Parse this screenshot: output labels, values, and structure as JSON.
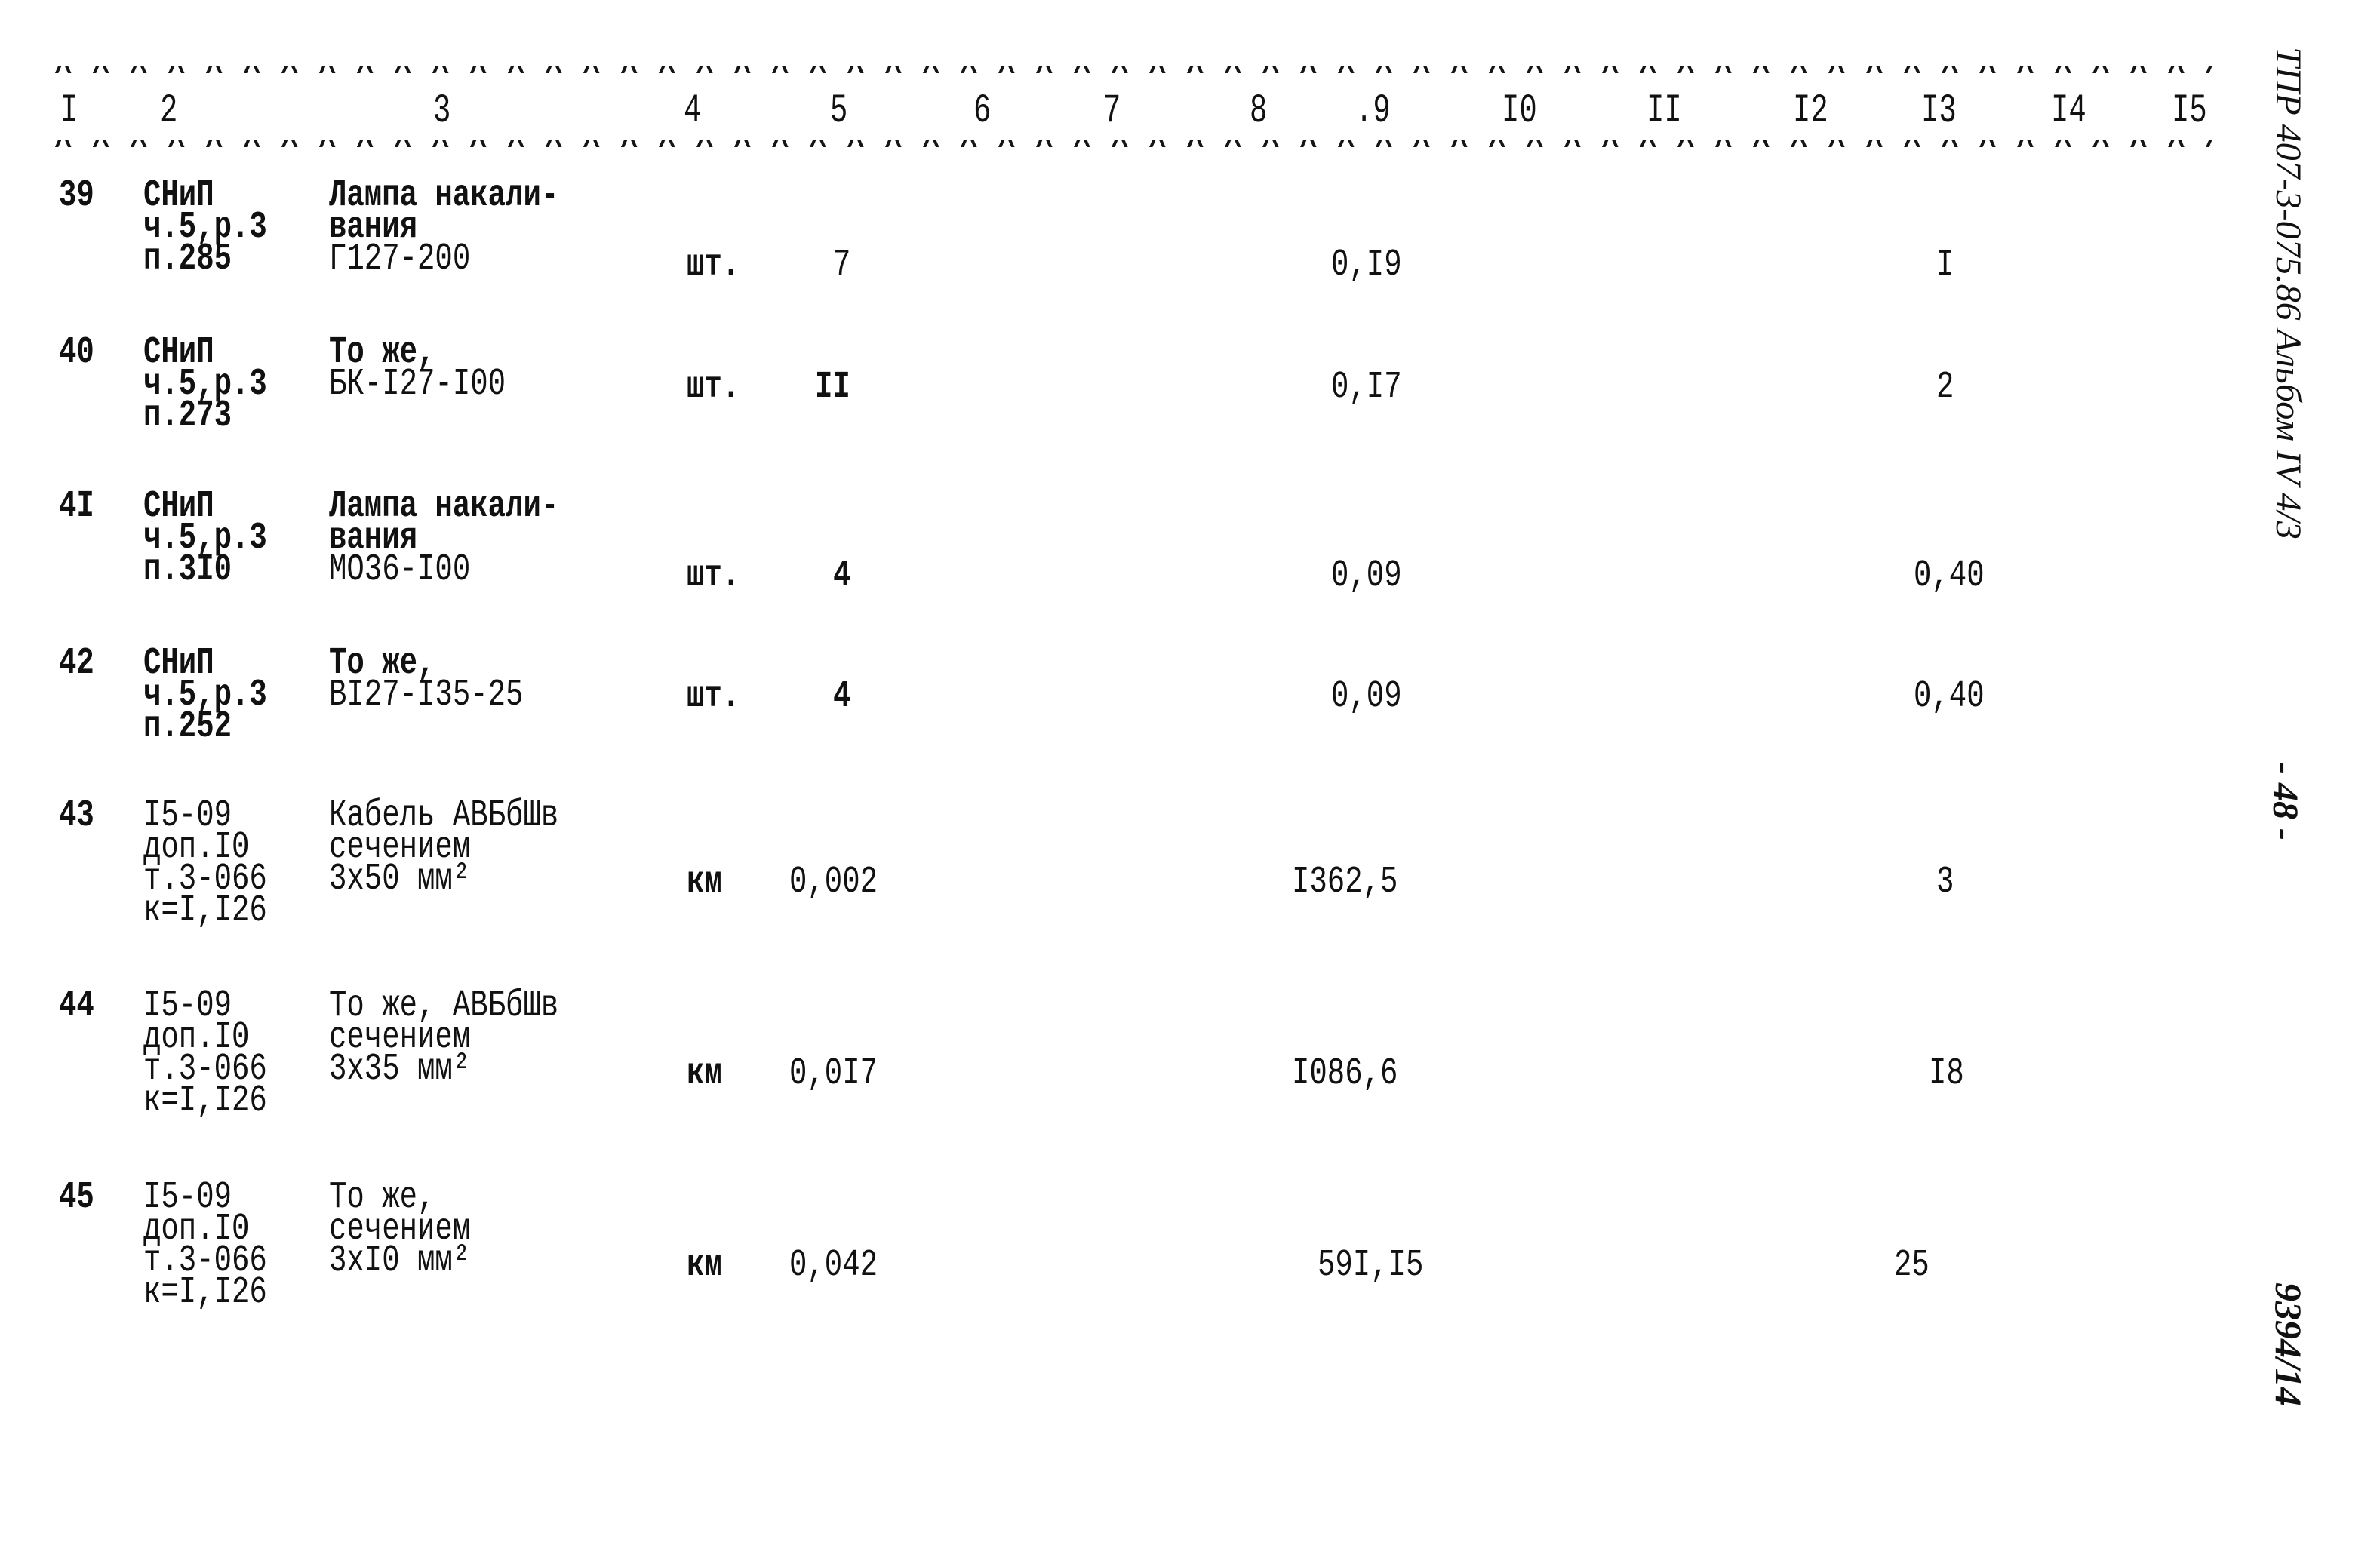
{
  "table": {
    "column_headers": [
      "I",
      "2",
      "3",
      "4",
      "5",
      "6",
      "7",
      "8",
      ".9",
      "I0",
      "II",
      "I2",
      "I3",
      "I4",
      "I5"
    ],
    "header_rule_glyphs": "^^^^^^^^^^^^^^^^^^^^^^^^^^^^^^^^^^^^^^^^^^^^^^^^^^^^^^^^^^^^^^^^^^^^^^^^^^^^^^^^^^^^^^^^^^^^^^^^^^^^^^^^^^^^^^^^^^^",
    "rows": [
      {
        "num": "39",
        "ref": [
          "СНиП",
          "ч.5,р.3",
          "п.285"
        ],
        "desc": [
          "Лампа накали-",
          "вания",
          "Г127-200"
        ],
        "unit": "шт.",
        "col5": "7",
        "col9": "0,I9",
        "col13": "I"
      },
      {
        "num": "40",
        "ref": [
          "СНиП",
          "ч.5,р.3",
          "п.273"
        ],
        "desc": [
          "То же,",
          "БК-I27-I00"
        ],
        "unit": "шт.",
        "col5": "II",
        "col9": "0,I7",
        "col13": "2"
      },
      {
        "num": "4I",
        "ref": [
          "СНиП",
          "ч.5,р.3",
          "п.3I0"
        ],
        "desc": [
          "Лампа накали-",
          "вания",
          "МО36-I00"
        ],
        "unit": "шт.",
        "col5": "4",
        "col9": "0,09",
        "col13": "0,40"
      },
      {
        "num": "42",
        "ref": [
          "СНиП",
          "ч.5,р.3",
          "п.252"
        ],
        "desc": [
          "То же,",
          "ВI27-I35-25"
        ],
        "unit": "шт.",
        "col5": "4",
        "col9": "0,09",
        "col13": "0,40"
      },
      {
        "num": "43",
        "ref": [
          "I5-09",
          "доп.I0",
          "т.3-066",
          "к=I,I26"
        ],
        "desc": [
          "Кабель АВБбШв",
          "сечением",
          "3х50 мм²"
        ],
        "unit": "км",
        "col5": "0,002",
        "col9": "I362,5",
        "col13": "3"
      },
      {
        "num": "44",
        "ref": [
          "I5-09",
          "доп.I0",
          "т.3-066",
          "к=I,I26"
        ],
        "desc": [
          "То же, АВБбШв",
          "сечением",
          "3х35 мм²"
        ],
        "unit": "км",
        "col5": "0,0I7",
        "col9": "I086,6",
        "col13": "I8"
      },
      {
        "num": "45",
        "ref": [
          "I5-09",
          "доп.I0",
          "т.3-066",
          "к=I,I26"
        ],
        "desc": [
          "То же,",
          "сечением",
          "3хI0 мм²"
        ],
        "unit": "км",
        "col5": "0,042",
        "col9": "59I,I5",
        "col13": "25"
      }
    ]
  },
  "margin": {
    "document_code": "ТПР 407-3-075.86 Альбом IV 4/3",
    "page_number": "- 48 -",
    "inventory_number": "9394/14"
  }
}
